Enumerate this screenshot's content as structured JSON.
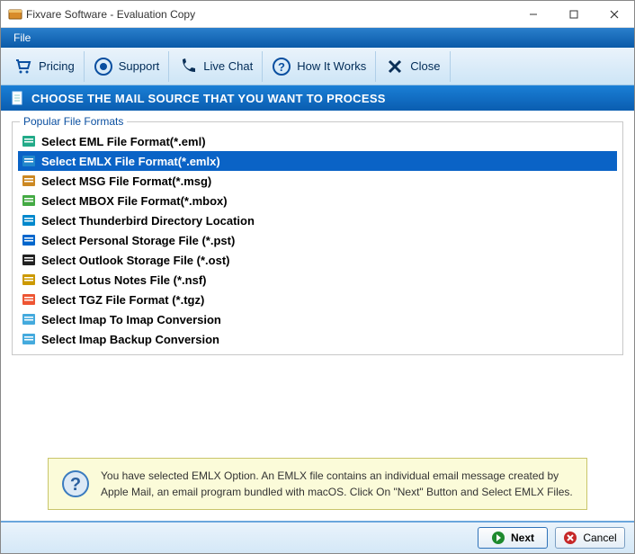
{
  "window": {
    "title": "Fixvare Software - Evaluation Copy"
  },
  "menubar": {
    "file": "File"
  },
  "toolbar": {
    "pricing": "Pricing",
    "support": "Support",
    "livechat": "Live Chat",
    "howitworks": "How It Works",
    "close": "Close"
  },
  "banner": {
    "text": "CHOOSE THE MAIL SOURCE THAT YOU WANT TO PROCESS"
  },
  "group": {
    "legend": "Popular File Formats"
  },
  "formats": [
    {
      "label": "Select EML File Format(*.eml)"
    },
    {
      "label": "Select EMLX File Format(*.emlx)"
    },
    {
      "label": "Select MSG File Format(*.msg)"
    },
    {
      "label": "Select MBOX File Format(*.mbox)"
    },
    {
      "label": "Select Thunderbird Directory Location"
    },
    {
      "label": "Select Personal Storage File (*.pst)"
    },
    {
      "label": "Select Outlook Storage File (*.ost)"
    },
    {
      "label": "Select Lotus Notes File (*.nsf)"
    },
    {
      "label": "Select TGZ File Format (*.tgz)"
    },
    {
      "label": "Select Imap To Imap Conversion"
    },
    {
      "label": "Select Imap Backup Conversion"
    }
  ],
  "selected_index": 1,
  "info": {
    "text": "You have selected EMLX Option. An EMLX file contains an individual email message created by Apple Mail, an email program bundled with macOS. Click On \"Next\" Button and Select EMLX Files."
  },
  "footer": {
    "next": "Next",
    "cancel": "Cancel"
  }
}
